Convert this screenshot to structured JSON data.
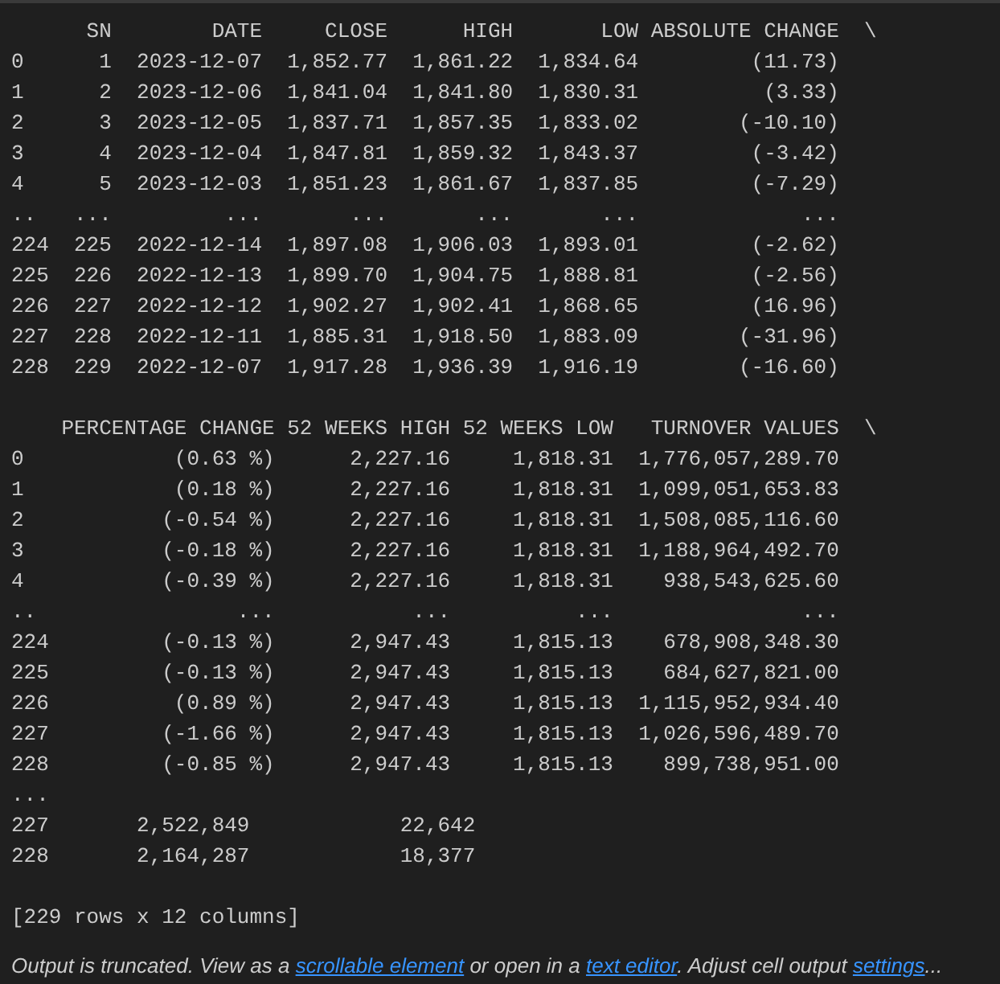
{
  "output": {
    "blocks": [
      {
        "lines": [
          "      SN        DATE     CLOSE      HIGH       LOW ABSOLUTE CHANGE  \\",
          "0      1  2023-12-07  1,852.77  1,861.22  1,834.64         (11.73)",
          "1      2  2023-12-06  1,841.04  1,841.80  1,830.31          (3.33)",
          "2      3  2023-12-05  1,837.71  1,857.35  1,833.02        (-10.10)",
          "3      4  2023-12-04  1,847.81  1,859.32  1,843.37         (-3.42)",
          "4      5  2023-12-03  1,851.23  1,861.67  1,837.85         (-7.29)",
          "..   ...         ...       ...       ...       ...             ...",
          "224  225  2022-12-14  1,897.08  1,906.03  1,893.01         (-2.62)",
          "225  226  2022-12-13  1,899.70  1,904.75  1,888.81         (-2.56)",
          "226  227  2022-12-12  1,902.27  1,902.41  1,868.65         (16.96)",
          "227  228  2022-12-11  1,885.31  1,918.50  1,883.09        (-31.96)",
          "228  229  2022-12-07  1,917.28  1,936.39  1,916.19        (-16.60)"
        ]
      },
      {
        "lines": [
          "    PERCENTAGE CHANGE 52 WEEKS HIGH 52 WEEKS LOW   TURNOVER VALUES  \\",
          "0            (0.63 %)      2,227.16     1,818.31  1,776,057,289.70",
          "1            (0.18 %)      2,227.16     1,818.31  1,099,051,653.83",
          "2           (-0.54 %)      2,227.16     1,818.31  1,508,085,116.60",
          "3           (-0.18 %)      2,227.16     1,818.31  1,188,964,492.70",
          "4           (-0.39 %)      2,227.16     1,818.31    938,543,625.60",
          "..                ...           ...          ...               ...",
          "224         (-0.13 %)      2,947.43     1,815.13    678,908,348.30",
          "225         (-0.13 %)      2,947.43     1,815.13    684,627,821.00",
          "226          (0.89 %)      2,947.43     1,815.13  1,115,952,934.40",
          "227         (-1.66 %)      2,947.43     1,815.13  1,026,596,489.70",
          "228         (-0.85 %)      2,947.43     1,815.13    899,738,951.00",
          "...",
          "227       2,522,849            22,642",
          "228       2,164,287            18,377"
        ]
      },
      {
        "lines": [
          "[229 rows x 12 columns]"
        ]
      }
    ],
    "notice": [
      {
        "kind": "text",
        "text": "Output is truncated. View as a "
      },
      {
        "kind": "link",
        "text": "scrollable element"
      },
      {
        "kind": "text",
        "text": " or open in a "
      },
      {
        "kind": "link",
        "text": "text editor"
      },
      {
        "kind": "text",
        "text": ". Adjust cell output "
      },
      {
        "kind": "link",
        "text": "settings"
      },
      {
        "kind": "text",
        "text": "..."
      }
    ]
  }
}
